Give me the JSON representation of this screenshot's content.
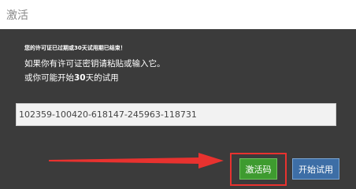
{
  "window": {
    "title": "激活"
  },
  "dialog": {
    "notice": "您的许可证已过期或30天试用期已结束！",
    "line1": "如果你有许可证密钥请粘贴或输入它。",
    "line2_prefix": "或你可能开始",
    "line2_bold": "30",
    "line2_suffix": "天的试用"
  },
  "license_key": {
    "value": "102359-100420-618147-245963-118731"
  },
  "buttons": {
    "activate_label": "激活码",
    "start_trial_label": "开始试用"
  },
  "colors": {
    "activate_button": "#3e9b2f",
    "trial_button": "#3d6ea6",
    "highlight_red": "#e8322f",
    "dialog_bg": "#3b3b3b"
  }
}
